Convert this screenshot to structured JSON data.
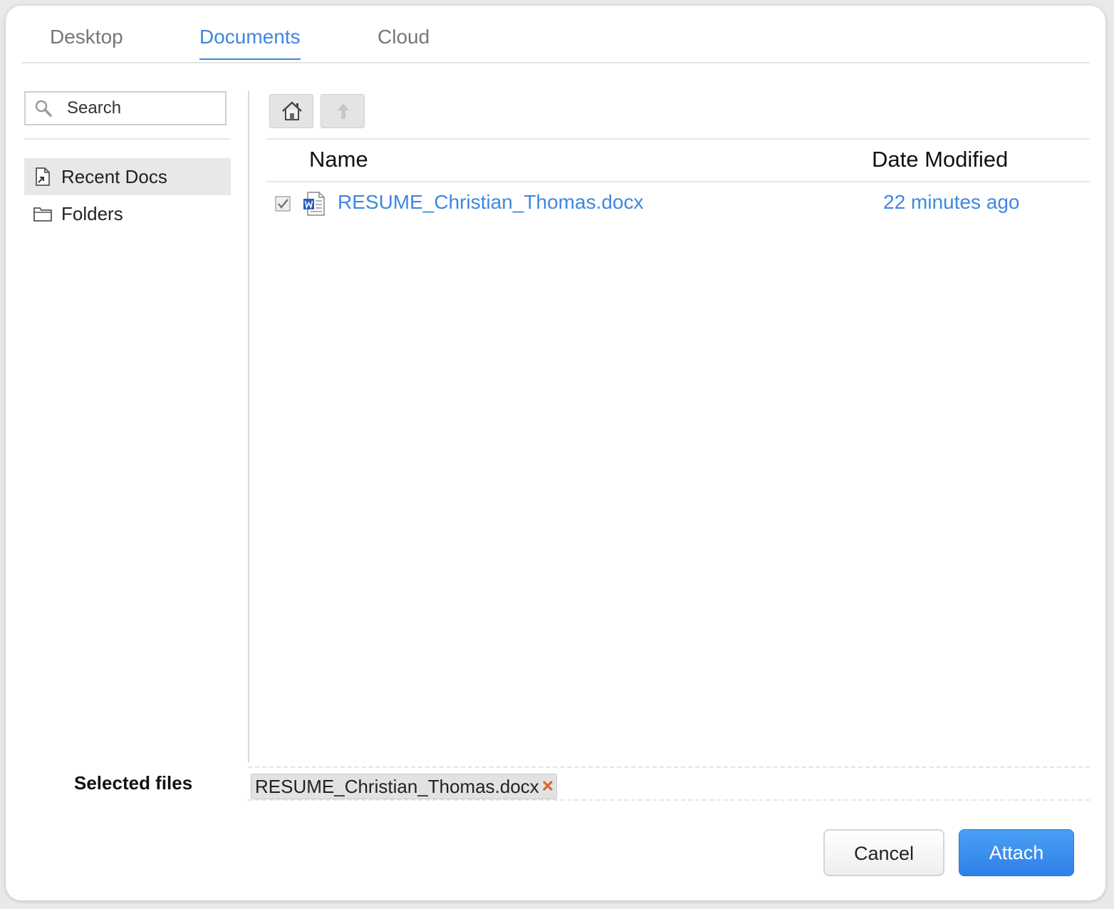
{
  "tabs": [
    {
      "label": "Desktop",
      "active": false
    },
    {
      "label": "Documents",
      "active": true
    },
    {
      "label": "Cloud",
      "active": false
    }
  ],
  "sidebar": {
    "search_placeholder": "Search",
    "items": [
      {
        "label": "Recent Docs",
        "icon": "recent-docs-icon",
        "selected": true
      },
      {
        "label": "Folders",
        "icon": "folder-icon",
        "selected": false
      }
    ]
  },
  "toolbar": {
    "home_icon": "home-icon",
    "up_icon": "up-arrow-icon",
    "up_disabled": true
  },
  "file_list": {
    "columns": {
      "name": "Name",
      "date": "Date Modified"
    },
    "rows": [
      {
        "checked": true,
        "icon": "word-document-icon",
        "name": "RESUME_Christian_Thomas.docx",
        "date": "22 minutes ago"
      }
    ]
  },
  "selected": {
    "label": "Selected files",
    "files": [
      "RESUME_Christian_Thomas.docx"
    ]
  },
  "buttons": {
    "cancel": "Cancel",
    "attach": "Attach"
  },
  "colors": {
    "accent": "#3f87e0",
    "attach_button": "#3b8bef",
    "remove_x": "#d46a2a"
  }
}
